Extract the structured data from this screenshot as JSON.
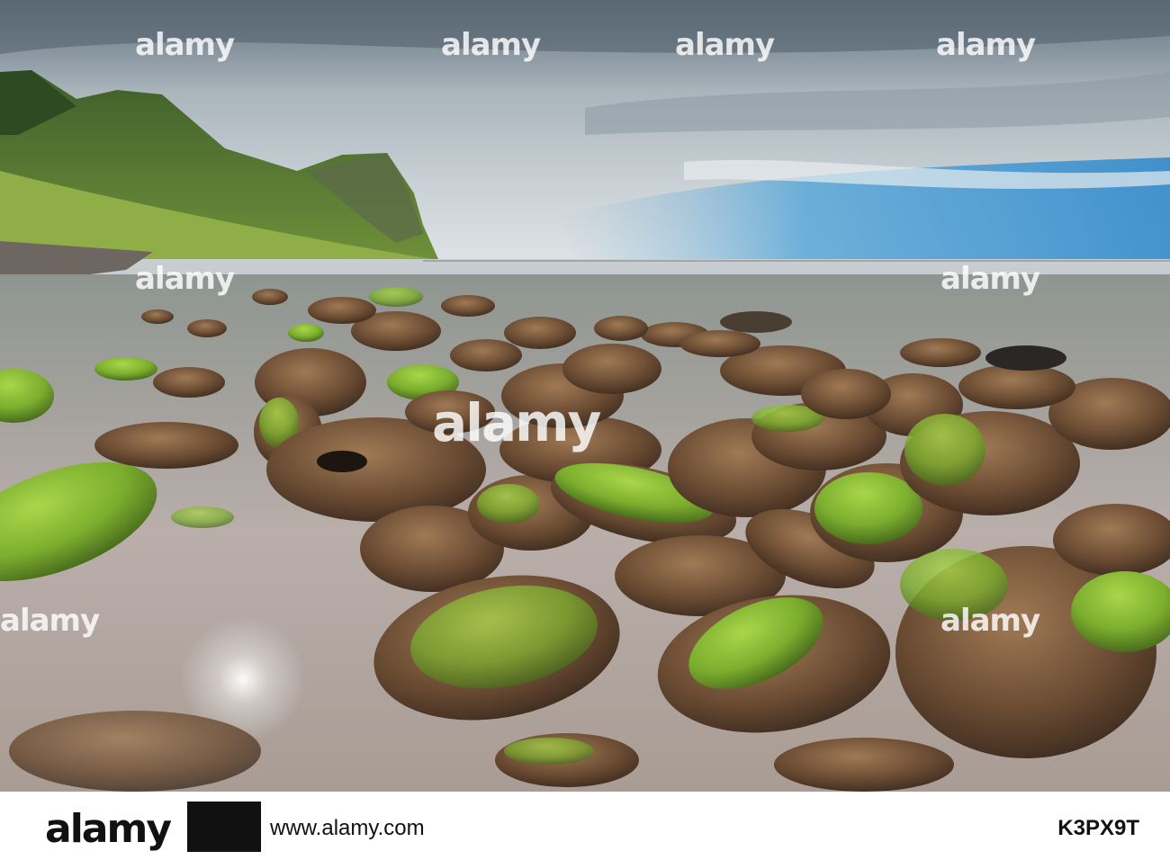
{
  "photo": {
    "subject": "coastal-boulders-landscape",
    "watermark_text": "alamy",
    "colors": {
      "sky_top": "#6f8090",
      "sky_blue": "#2e8fd0",
      "sea": "#c2c8cc",
      "moss": "#7fb832",
      "rock": "#6b4e35",
      "mountain": "#3f6a2a"
    }
  },
  "footer": {
    "logo": "alamy",
    "url": "www.alamy.com",
    "image_id": "K3PX9T"
  }
}
